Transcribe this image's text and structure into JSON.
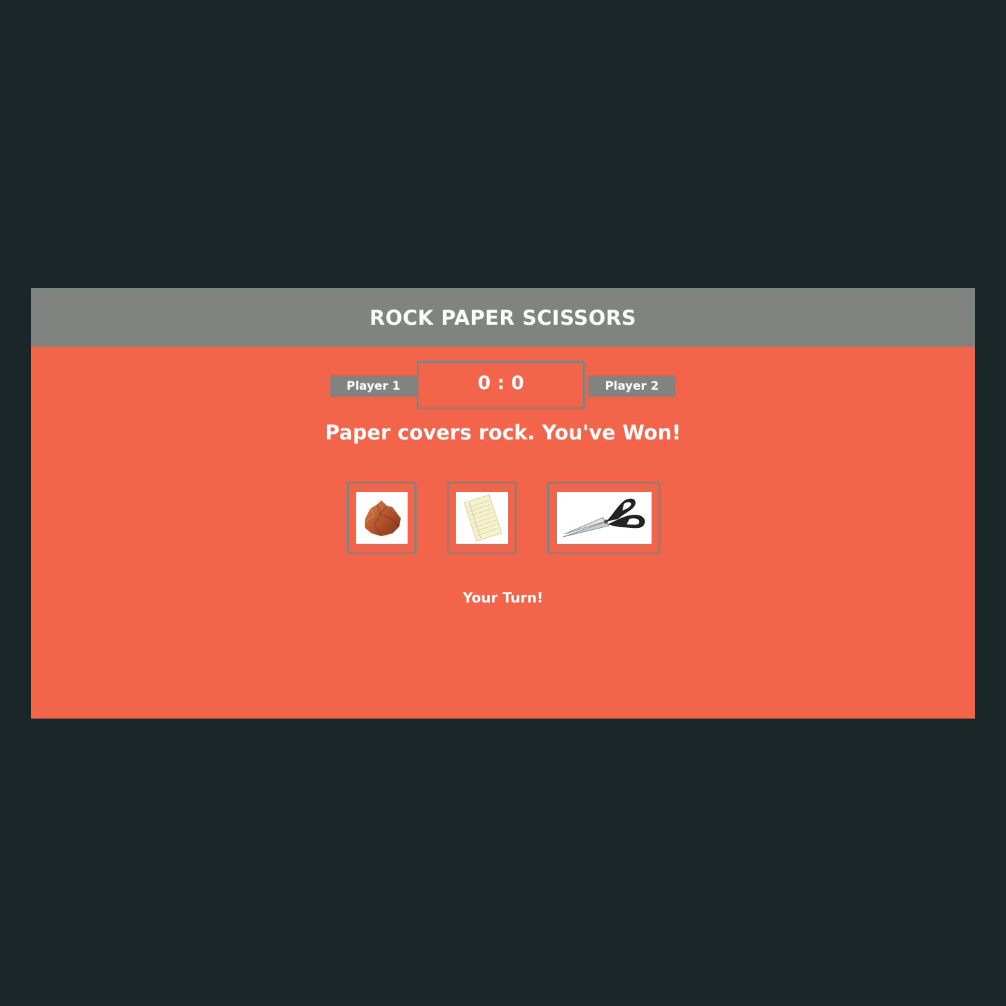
{
  "header": {
    "title": "ROCK PAPER SCISSORS"
  },
  "scoreboard": {
    "player1_label": "Player 1",
    "player2_label": "Player 2",
    "score_text": "0 : 0"
  },
  "message": "Paper covers rock. You've Won!",
  "choices": [
    {
      "name": "rock",
      "icon": "rock-icon"
    },
    {
      "name": "paper",
      "icon": "paper-icon"
    },
    {
      "name": "scissors",
      "icon": "scissors-icon"
    }
  ],
  "status": "Your Turn!",
  "colors": {
    "background": "#1b2628",
    "panel": "#f2654a",
    "header": "#818381",
    "text": "#ffffff"
  }
}
